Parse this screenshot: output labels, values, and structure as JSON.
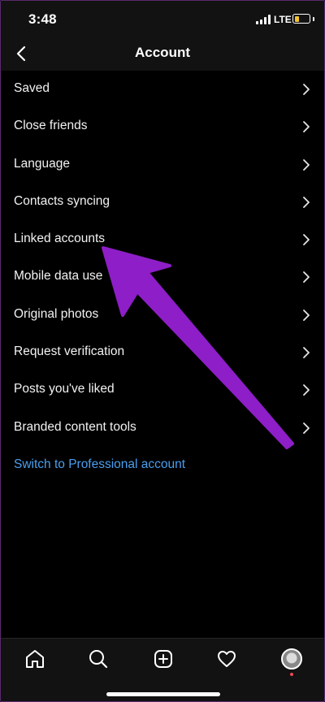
{
  "status_bar": {
    "time": "3:48",
    "network": "LTE",
    "battery_level": 0.3,
    "battery_color": "#f4c430"
  },
  "header": {
    "title": "Account",
    "back_icon": "chevron-left-icon"
  },
  "menu": {
    "items": [
      {
        "label": "Saved"
      },
      {
        "label": "Close friends"
      },
      {
        "label": "Language"
      },
      {
        "label": "Contacts syncing"
      },
      {
        "label": "Linked accounts"
      },
      {
        "label": "Mobile data use"
      },
      {
        "label": "Original photos"
      },
      {
        "label": "Request verification"
      },
      {
        "label": "Posts you've liked"
      },
      {
        "label": "Branded content tools"
      }
    ],
    "professional_link": "Switch to Professional account"
  },
  "colors": {
    "background": "#000000",
    "bar_background": "#121212",
    "link_blue": "#4a9ff0",
    "annotation_arrow": "#8e1ec7"
  },
  "bottom_nav": {
    "icons": [
      "home-icon",
      "search-icon",
      "add-post-icon",
      "activity-heart-icon",
      "profile-avatar"
    ]
  }
}
